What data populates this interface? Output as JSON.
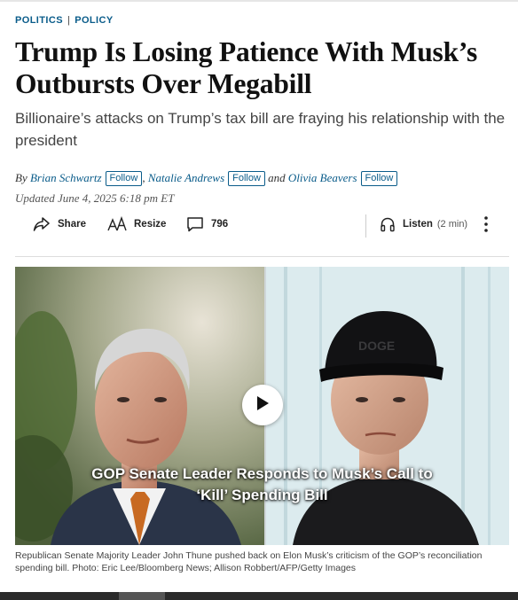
{
  "breadcrumbs": {
    "section": "POLITICS",
    "separator": "|",
    "subsection": "POLICY"
  },
  "headline": "Trump Is Losing Patience With Musk’s Outbursts Over Megabill",
  "dek": "Billionaire’s attacks on Trump’s tax bill are fraying his relationship with the president",
  "byline": {
    "prefix": "By",
    "authors": [
      {
        "name": "Brian Schwartz",
        "follow": "Follow"
      },
      {
        "name": "Natalie Andrews",
        "follow": "Follow"
      },
      {
        "name": "Olivia Beavers",
        "follow": "Follow"
      }
    ],
    "comma": ",",
    "and": "and"
  },
  "updated": "Updated June 4, 2025 6:18 pm ET",
  "toolbar": {
    "share": {
      "label": "Share",
      "icon": "share-icon"
    },
    "resize": {
      "label": "Resize",
      "icon": "resize-text-icon"
    },
    "comments": {
      "count": "796",
      "icon": "comment-icon"
    },
    "listen": {
      "label": "Listen",
      "duration": "(2 min)",
      "icon": "headphones-icon"
    },
    "more": {
      "icon": "more-vertical-icon"
    }
  },
  "media": {
    "video_title_line1": "GOP Senate Leader Responds to Musk’s Call to",
    "video_title_line2": "‘Kill’ Spending Bill",
    "play_icon": "play-icon",
    "cap_logo_text": "DOGE"
  },
  "caption": "Republican Senate Majority Leader John Thune pushed back on Elon Musk’s criticism of the GOP’s reconciliation spending bill. Photo: Eric Lee/Bloomberg News; Allison Robbert/AFP/Getty Images",
  "colors": {
    "link": "#0a5c8a",
    "headline": "#111111",
    "dek": "#444444"
  }
}
